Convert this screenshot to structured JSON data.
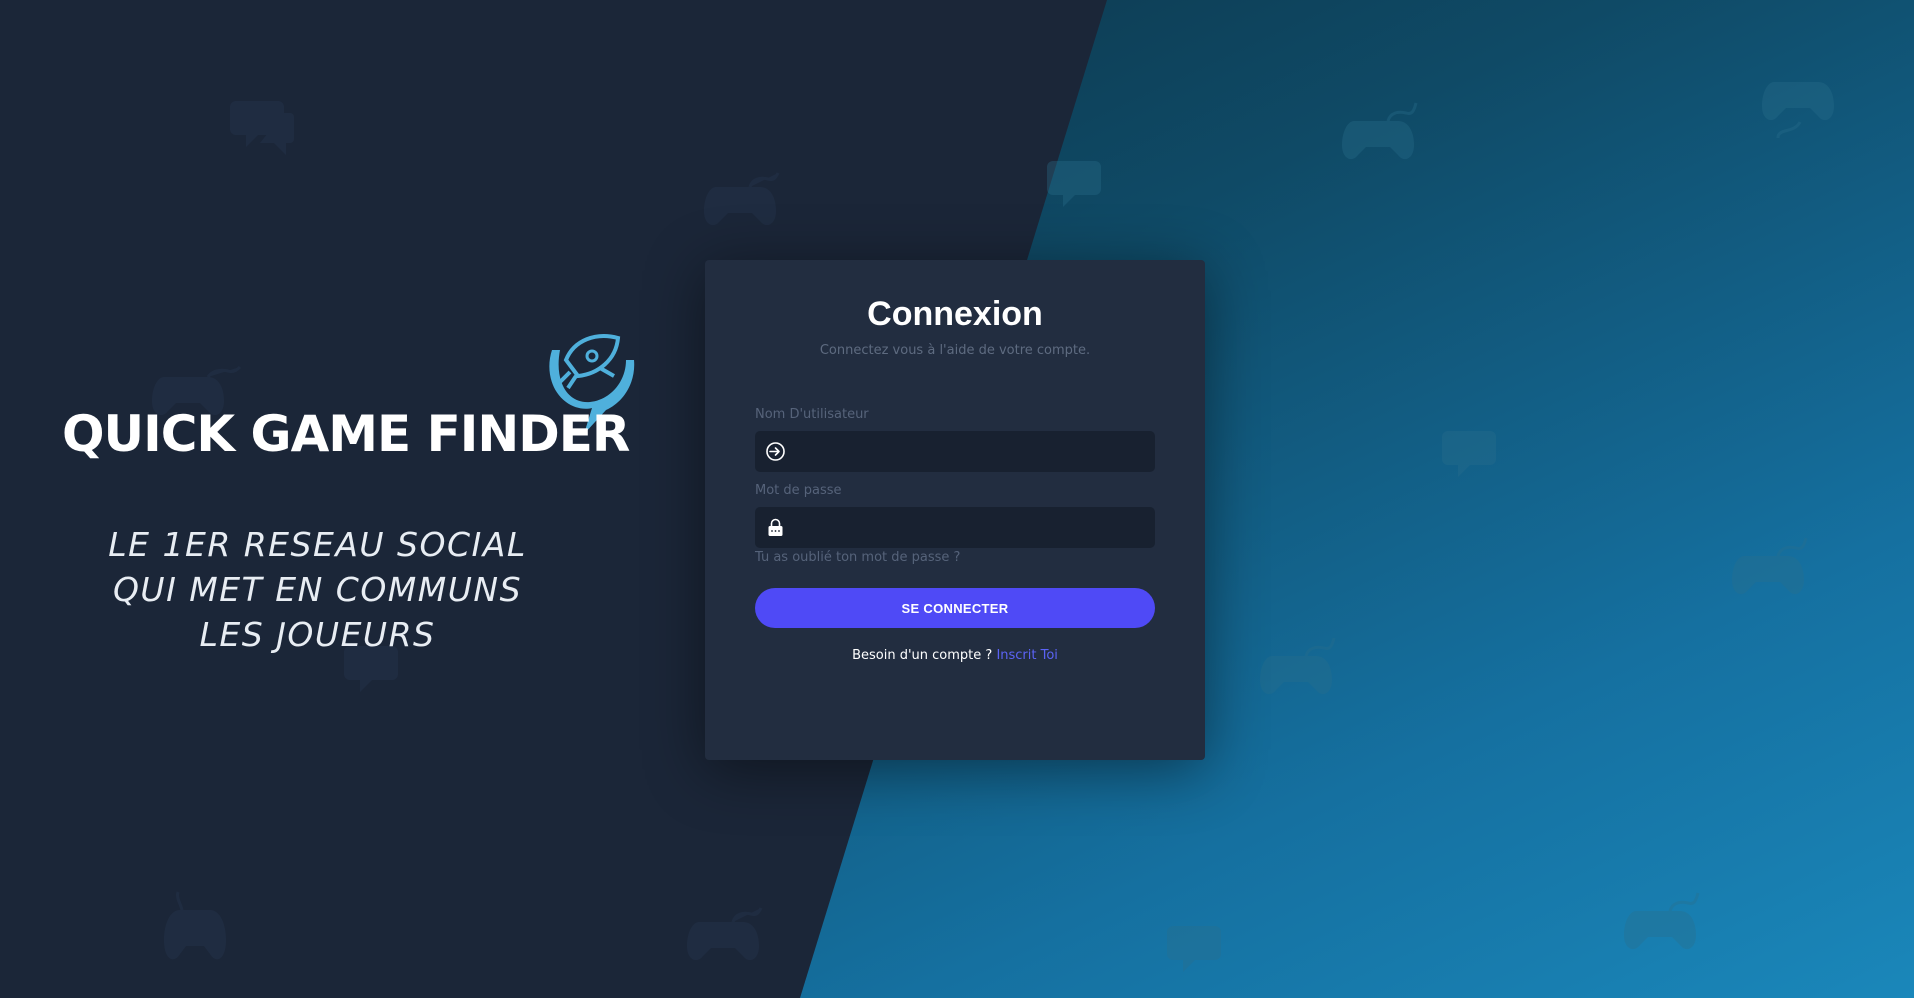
{
  "brand": {
    "name": "QUICK GAME FINDER",
    "tagline": [
      "LE 1ER RESEAU SOCIAL",
      "QUI MET EN COMMUNS",
      "LES JOUEURS"
    ]
  },
  "login": {
    "title": "Connexion",
    "subtitle": "Connectez vous à l'aide de votre compte.",
    "username_label": "Nom D'utilisateur",
    "username_value": "",
    "password_label": "Mot de passe",
    "password_value": "",
    "forgot_link": "Tu as oublié ton mot de passe ?",
    "submit_label": "SE CONNECTER",
    "signup_prompt": "Besoin d'un compte ?",
    "signup_link": "Inscrit Toi"
  },
  "colors": {
    "background_dark": "#1b2638",
    "background_teal": "#1a87ba",
    "card": "#222d40",
    "input": "#182130",
    "button": "#4f4af6",
    "link": "#5b63f5",
    "logo": "#4fb0dc"
  },
  "icons": {
    "username": "login-arrow-icon",
    "password": "lock-icon",
    "logo": "rocket-chat-bubble-icon",
    "decorations": [
      "gamepad-icon",
      "chat-bubble-icon"
    ]
  }
}
